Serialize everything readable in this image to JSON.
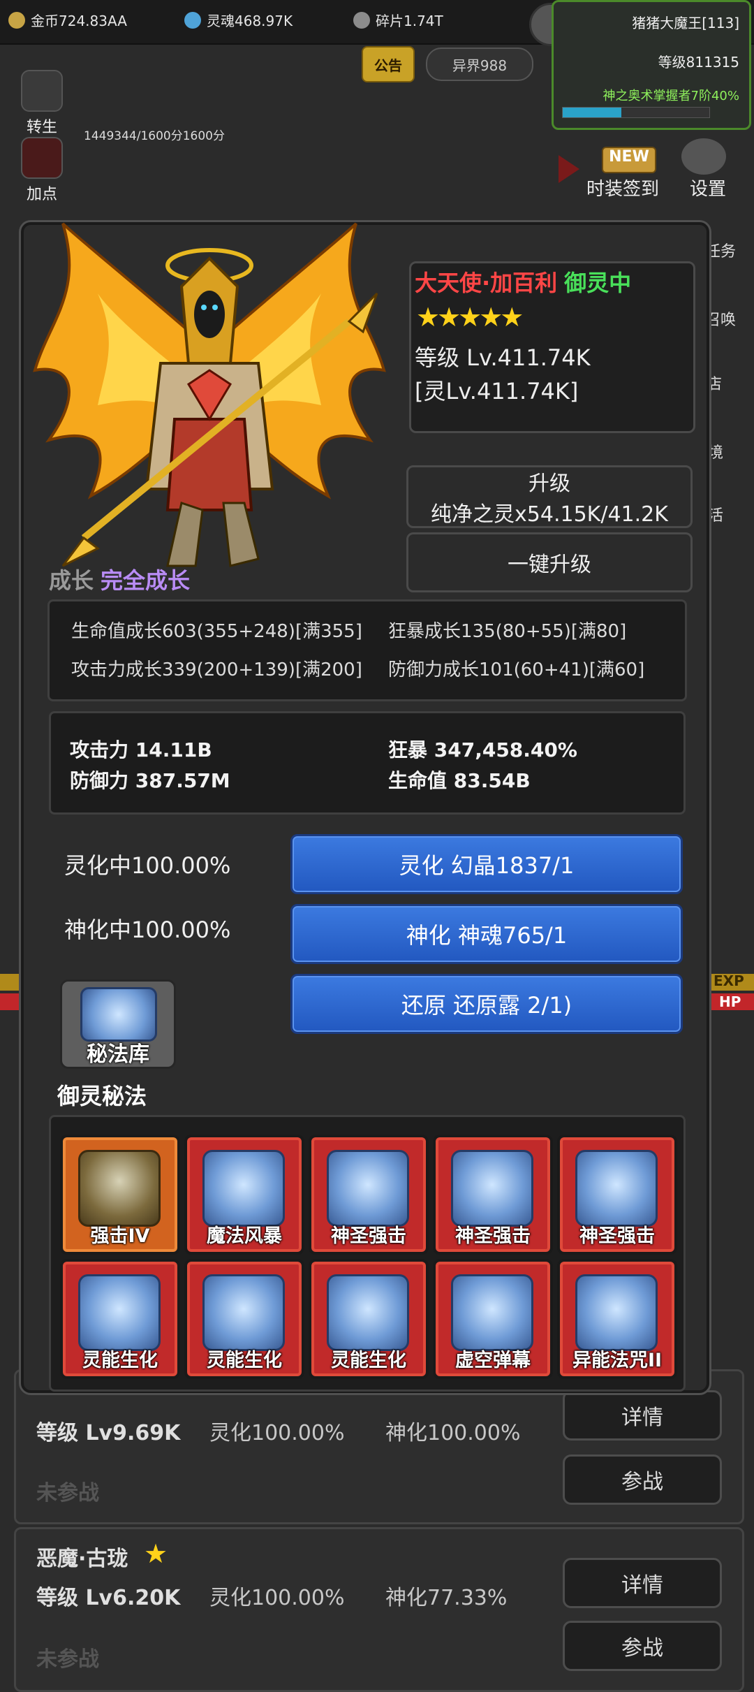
{
  "top": {
    "gold": "金币724.83AA",
    "soul": "灵魂468.97K",
    "shard": "碎片1.74T",
    "player_name": "猪猪大魔王[113]",
    "player_level": "等级811315",
    "title_progress": "神之奥术掌握者7阶40%",
    "notice": "公告",
    "world": "异界988",
    "left_menu": [
      "转生",
      "加点"
    ],
    "right_menu": [
      "时装签到",
      "设置"
    ],
    "new_badge": "NEW",
    "score_text": "1449344/1600分1600分",
    "side_partial": [
      "任务",
      "召唤",
      "店",
      "境",
      "活"
    ],
    "exp": "EXP",
    "hp": "HP"
  },
  "spirit": {
    "name": "大天使·加百利",
    "status": "御灵中",
    "stars": "★★★★★",
    "level": "等级 Lv.411.74K",
    "spirit_level": "[灵Lv.411.74K]",
    "upgrade_title": "升级",
    "upgrade_cost": "纯净之灵x54.15K/41.2K",
    "one_key": "一键升级",
    "growth_label": "成长",
    "growth_status": "完全成长",
    "growth": [
      "生命值成长603(355+248)[满355]",
      "狂暴成长135(80+55)[满80]",
      "攻击力成长339(200+139)[满200]",
      "防御力成长101(60+41)[满60]"
    ],
    "stats": [
      "攻击力 14.11B",
      "狂暴 347,458.40%",
      "防御力 387.57M",
      "生命值 83.54B"
    ],
    "lingization": "灵化中100.00%",
    "deification": "神化中100.00%",
    "btn_ling": "灵化 幻晶1837/1",
    "btn_shen": "神化 神魂765/1",
    "btn_restore": "还原 还原露 2/1)",
    "library": "秘法库",
    "section": "御灵秘法",
    "skills": [
      "强击IV",
      "魔法风暴",
      "神圣强击",
      "神圣强击",
      "神圣强击",
      "灵能生化",
      "灵能生化",
      "灵能生化",
      "虚空弹幕",
      "异能法咒II"
    ]
  },
  "list": {
    "card1": {
      "level": "等级 Lv9.69K",
      "ling": "灵化100.00%",
      "shen": "神化100.00%",
      "state": "未参战",
      "detail": "详情",
      "battle": "参战"
    },
    "card2": {
      "name": "恶魔·古珑",
      "level": "等级 Lv6.20K",
      "ling": "灵化100.00%",
      "shen": "神化77.33%",
      "state": "未参战",
      "detail": "详情",
      "battle": "参战"
    }
  }
}
